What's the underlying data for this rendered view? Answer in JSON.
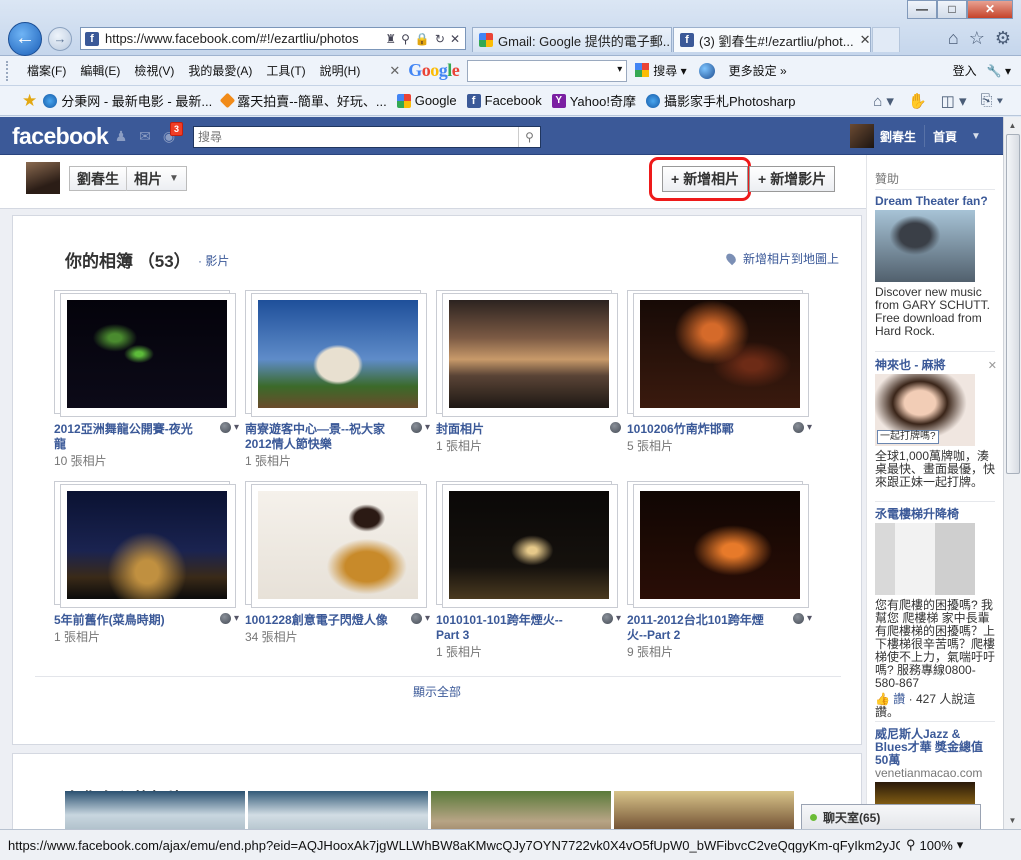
{
  "browser": {
    "address_url": "https://www.facebook.com/#!/ezartliu/photos",
    "tabs": [
      {
        "label": "Gmail: Google 提供的電子郵...",
        "icon": "gmail-icon"
      },
      {
        "label": "(3) 劉春生#!/ezartliu/phot...",
        "icon": "facebook-icon",
        "active": true
      }
    ],
    "menu": [
      "檔案(F)",
      "編輯(E)",
      "檢視(V)",
      "我的最愛(A)",
      "工具(T)",
      "說明(H)"
    ],
    "google_search_label": "搜尋",
    "google_logo": "Google",
    "more_settings": "更多設定 »",
    "signin": "登入",
    "favorites": [
      {
        "label": "分秉网 - 最新电影 - 最新...",
        "icon": "ie-page-icon"
      },
      {
        "label": "露天拍賣--簡單、好玩、...",
        "icon": "ruten-icon"
      },
      {
        "label": "Google",
        "icon": "google-icon"
      },
      {
        "label": "Facebook",
        "icon": "facebook-icon"
      },
      {
        "label": "Yahoo!奇摩",
        "icon": "yahoo-icon"
      },
      {
        "label": "攝影家手札Photosharp",
        "icon": "ie-page-icon"
      }
    ],
    "status_url": "https://www.facebook.com/ajax/emu/end.php?eid=AQJHooxAk7jgWLLWhBW8aKMwcQJy7OYN7722vk0X4vO5fUpW0_bWFibvcC2veQqgyKm-qFyIkm2yJGbn",
    "zoom": "100%"
  },
  "facebook": {
    "logo": "facebook",
    "notification_count": "3",
    "search_placeholder": "搜尋",
    "user_name": "劉春生",
    "home": "首頁",
    "profile_name": "劉春生",
    "section": "相片",
    "add_photos": "新增相片",
    "add_video": "新增影片",
    "plus": "+",
    "albums_heading": "你的相簿",
    "albums_count": "（53）",
    "videos_link": "· 影片",
    "map_link": "新增相片到地圖上",
    "albums": [
      {
        "title": "2012亞洲舞龍公開賽-夜光龍",
        "count": "10 張相片",
        "colors": [
          "#05020b",
          "#3a2f6b"
        ]
      },
      {
        "title": "南寮遊客中心—景--祝大家2012情人節快樂",
        "count": "1 張相片",
        "colors": [
          "#1f4e8f",
          "#d9c3a2"
        ]
      },
      {
        "title": "封面相片",
        "count": "1 張相片",
        "colors": [
          "#3a2a22",
          "#c99a6e"
        ]
      },
      {
        "title": "1010206竹南炸邯鄲",
        "count": "5 張相片",
        "colors": [
          "#1a0c08",
          "#7a3a1c"
        ]
      },
      {
        "title": "5年前舊作(菜鳥時期)",
        "count": "1 張相片",
        "colors": [
          "#0b1230",
          "#b88a3c"
        ]
      },
      {
        "title": "1001228創意電子閃燈人像",
        "count": "34 張相片",
        "colors": [
          "#f3efe9",
          "#c88a2a"
        ]
      },
      {
        "title": "1010101-101跨年煙火--Part 3",
        "count": "1 張相片",
        "colors": [
          "#0d0a08",
          "#8c6a38"
        ]
      },
      {
        "title": "2011-2012台北101跨年煙火--Part 2",
        "count": "9 張相片",
        "colors": [
          "#120704",
          "#c15a1a"
        ]
      }
    ],
    "show_all": "顯示全部",
    "tagged_heading": "有你在內的相片",
    "chat": "聊天室(65)"
  },
  "sidebar": {
    "heading": "贊助",
    "ads": [
      {
        "title": "Dream Theater fan?",
        "body": "Discover new music from GARY SCHUTT. Free download from Hard Rock."
      },
      {
        "title": "神來也 - 麻將",
        "caption": "一起打牌嗎?",
        "body": "全球1,000萬牌咖，湊桌最快、畫面最優，快來跟正妹一起打牌。"
      },
      {
        "title": "氶電樓梯升降椅",
        "body": "您有爬樓的困擾嗎? 我幫您 爬樓梯 家中長輩有爬樓梯的困擾嗎？上下樓梯很辛苦嗎？爬樓梯使不上力，氣喘吁吁嗎? 服務專線0800-580-867",
        "like": "讚",
        "like_count": "· 427 人說這讚。"
      },
      {
        "title": "威尼斯人Jazz & Blues才華 獎金總值50萬",
        "body": "venetianmacao.com"
      }
    ]
  }
}
